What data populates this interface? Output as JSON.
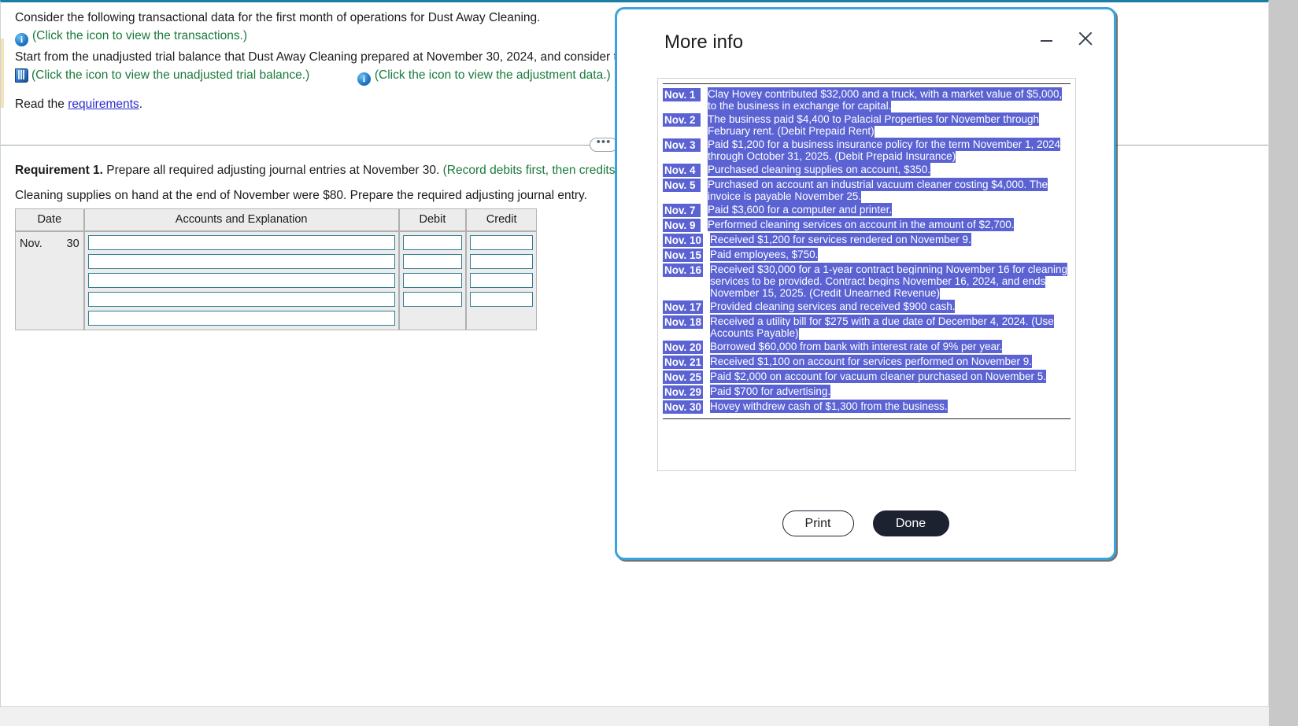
{
  "problem": {
    "line1": "Consider the following transactional data for the first month of operations for Dust Away Cleaning.",
    "transactions_hint": "(Click the icon to view the transactions.)",
    "line2": "Start from the unadjusted trial balance that Dust Away Cleaning prepared at November 30, 2024, and consider the following adjustment data.",
    "trial_balance_hint": "(Click the icon to view the unadjusted trial balance.)",
    "adjustment_hint": "(Click the icon to view the adjustment data.)",
    "read_prefix": "Read the ",
    "read_link": "requirements",
    "read_suffix": ".",
    "info_glyph": "i",
    "divider_dots": "•••"
  },
  "requirement": {
    "label": "Requirement 1.",
    "text": " Prepare all required adjusting journal entries at November 30. ",
    "hint": "(Record debits first, then credits. Select the explanation on the last line of the journal entry table.)",
    "subtext": "Cleaning supplies on hand at the end of November were $80. Prepare the required adjusting journal entry."
  },
  "journal": {
    "headers": {
      "date": "Date",
      "accounts": "Accounts and Explanation",
      "debit": "Debit",
      "credit": "Credit"
    },
    "date_month": "Nov.",
    "date_day": "30",
    "rows": [
      {
        "accounts": "",
        "debit": "",
        "credit": ""
      },
      {
        "accounts": "",
        "debit": "",
        "credit": ""
      },
      {
        "accounts": "",
        "debit": "",
        "credit": ""
      },
      {
        "accounts": "",
        "debit": "",
        "credit": ""
      },
      {
        "accounts": "",
        "debit": "",
        "credit": ""
      }
    ]
  },
  "modal": {
    "title": "More info",
    "minimize_label": "minimize",
    "close_label": "close",
    "print_label": "Print",
    "done_label": "Done",
    "transactions": [
      {
        "date": "Nov. 1",
        "text": "Clay Hovey contributed $32,000 and a truck, with a market value of $5,000, to the business in exchange for capital."
      },
      {
        "date": "Nov. 2",
        "text": "The business paid $4,400 to Palacial Properties for November through February rent. (Debit Prepaid Rent)"
      },
      {
        "date": "Nov. 3",
        "text": "Paid $1,200 for a business insurance policy for the term November 1, 2024 through October 31, 2025. (Debit Prepaid Insurance)"
      },
      {
        "date": "Nov. 4",
        "text": "Purchased cleaning supplies on account, $350."
      },
      {
        "date": "Nov. 5",
        "text": "Purchased on account an industrial vacuum cleaner costing $4,000. The invoice is payable November 25."
      },
      {
        "date": "Nov. 7",
        "text": "Paid $3,600 for a computer and printer."
      },
      {
        "date": "Nov. 9",
        "text": "Performed cleaning services on account in the amount of $2,700."
      },
      {
        "date": "Nov. 10",
        "text": "Received $1,200 for services rendered on November 9."
      },
      {
        "date": "Nov. 15",
        "text": "Paid employees, $750."
      },
      {
        "date": "Nov. 16",
        "text": "Received $30,000 for a 1-year contract beginning November 16 for cleaning services to be provided. Contract begins November 16, 2024, and ends November 15, 2025. (Credit Unearned Revenue)"
      },
      {
        "date": "Nov. 17",
        "text": "Provided cleaning services and received $900 cash."
      },
      {
        "date": "Nov. 18",
        "text": "Received a utility bill for $275 with a due date of December 4, 2024. (Use Accounts Payable)"
      },
      {
        "date": "Nov. 20",
        "text": "Borrowed $60,000 from bank with interest rate of 9% per year."
      },
      {
        "date": "Nov. 21",
        "text": "Received $1,100 on account for services performed on November 9."
      },
      {
        "date": "Nov. 25",
        "text": "Paid $2,000 on account for vacuum cleaner purchased on November 5."
      },
      {
        "date": "Nov. 29",
        "text": "Paid $700 for advertising."
      },
      {
        "date": "Nov. 30",
        "text": "Hovey withdrew cash of $1,300 from the business."
      }
    ]
  }
}
